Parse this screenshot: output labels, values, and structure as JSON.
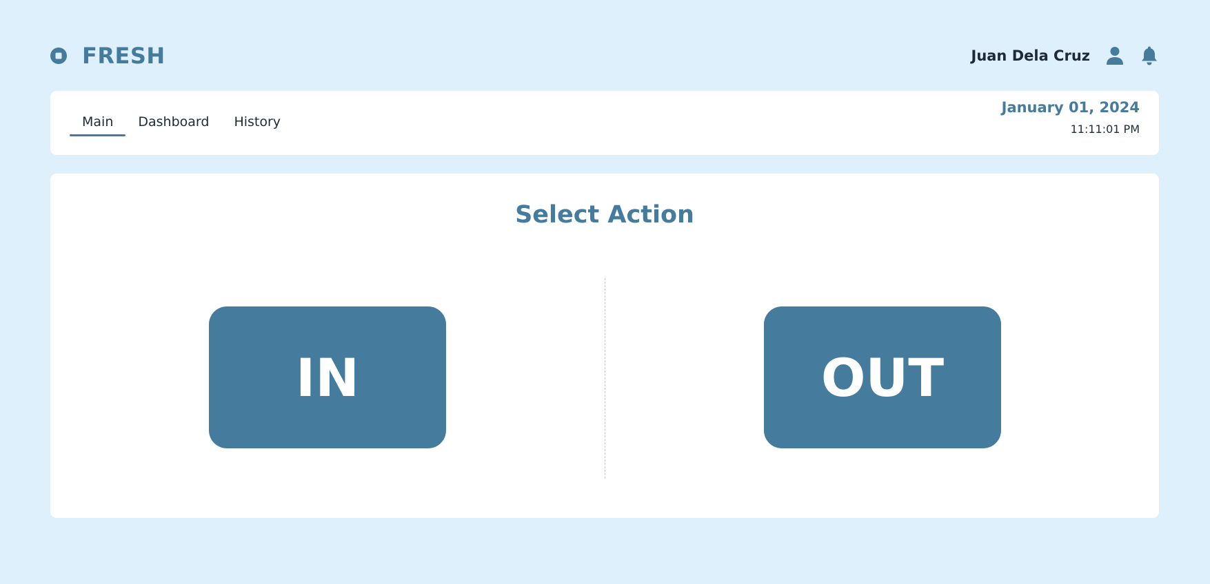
{
  "brand": {
    "icon": "circle-logo-icon",
    "name": "FRESH"
  },
  "user": {
    "name": "Juan Dela Cruz",
    "icons": [
      "user-icon",
      "bell-icon"
    ]
  },
  "nav": {
    "tabs": [
      {
        "label": "Main",
        "active": true
      },
      {
        "label": "Dashboard",
        "active": false
      },
      {
        "label": "History",
        "active": false
      }
    ],
    "date": "January 01, 2024",
    "time": "11:11:01 PM"
  },
  "main": {
    "title": "Select Action",
    "actions": {
      "in_label": "IN",
      "out_label": "OUT"
    }
  },
  "colors": {
    "background": "#def0fb",
    "accent": "#457b9d",
    "card": "#ffffff",
    "text": "#1f2a36"
  }
}
